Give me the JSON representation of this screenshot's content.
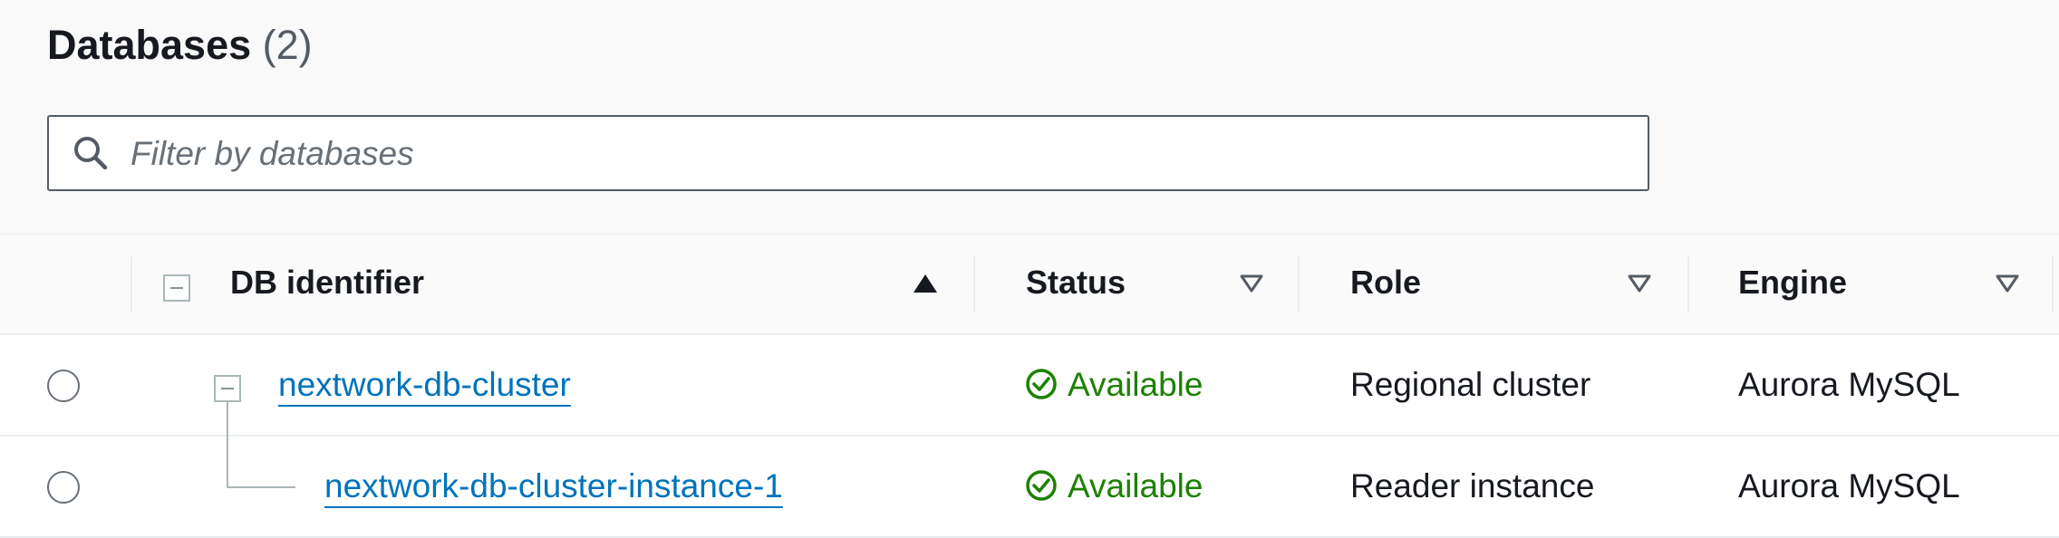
{
  "header": {
    "title": "Databases",
    "count": "(2)"
  },
  "search": {
    "placeholder": "Filter by databases",
    "value": ""
  },
  "columns": [
    {
      "label": "DB identifier",
      "sort": "ascending"
    },
    {
      "label": "Status",
      "sort": "none"
    },
    {
      "label": "Role",
      "sort": "none"
    },
    {
      "label": "Engine",
      "sort": "none"
    }
  ],
  "rows": [
    {
      "identifier": "nextwork-db-cluster",
      "status": "Available",
      "role": "Regional cluster",
      "engine": "Aurora MySQL",
      "selected": false
    },
    {
      "identifier": "nextwork-db-cluster-instance-1",
      "status": "Available",
      "role": "Reader instance",
      "engine": "Aurora MySQL",
      "selected": false
    }
  ],
  "colors": {
    "link": "#0073bb",
    "success": "#1d8102",
    "border": "#eaeded"
  },
  "icons": {
    "search": "search-icon",
    "sort_asc": "sort-ascending-icon",
    "sort_none": "sort-icon",
    "status_ok": "check-circle-icon",
    "expand": "collapse-icon"
  }
}
